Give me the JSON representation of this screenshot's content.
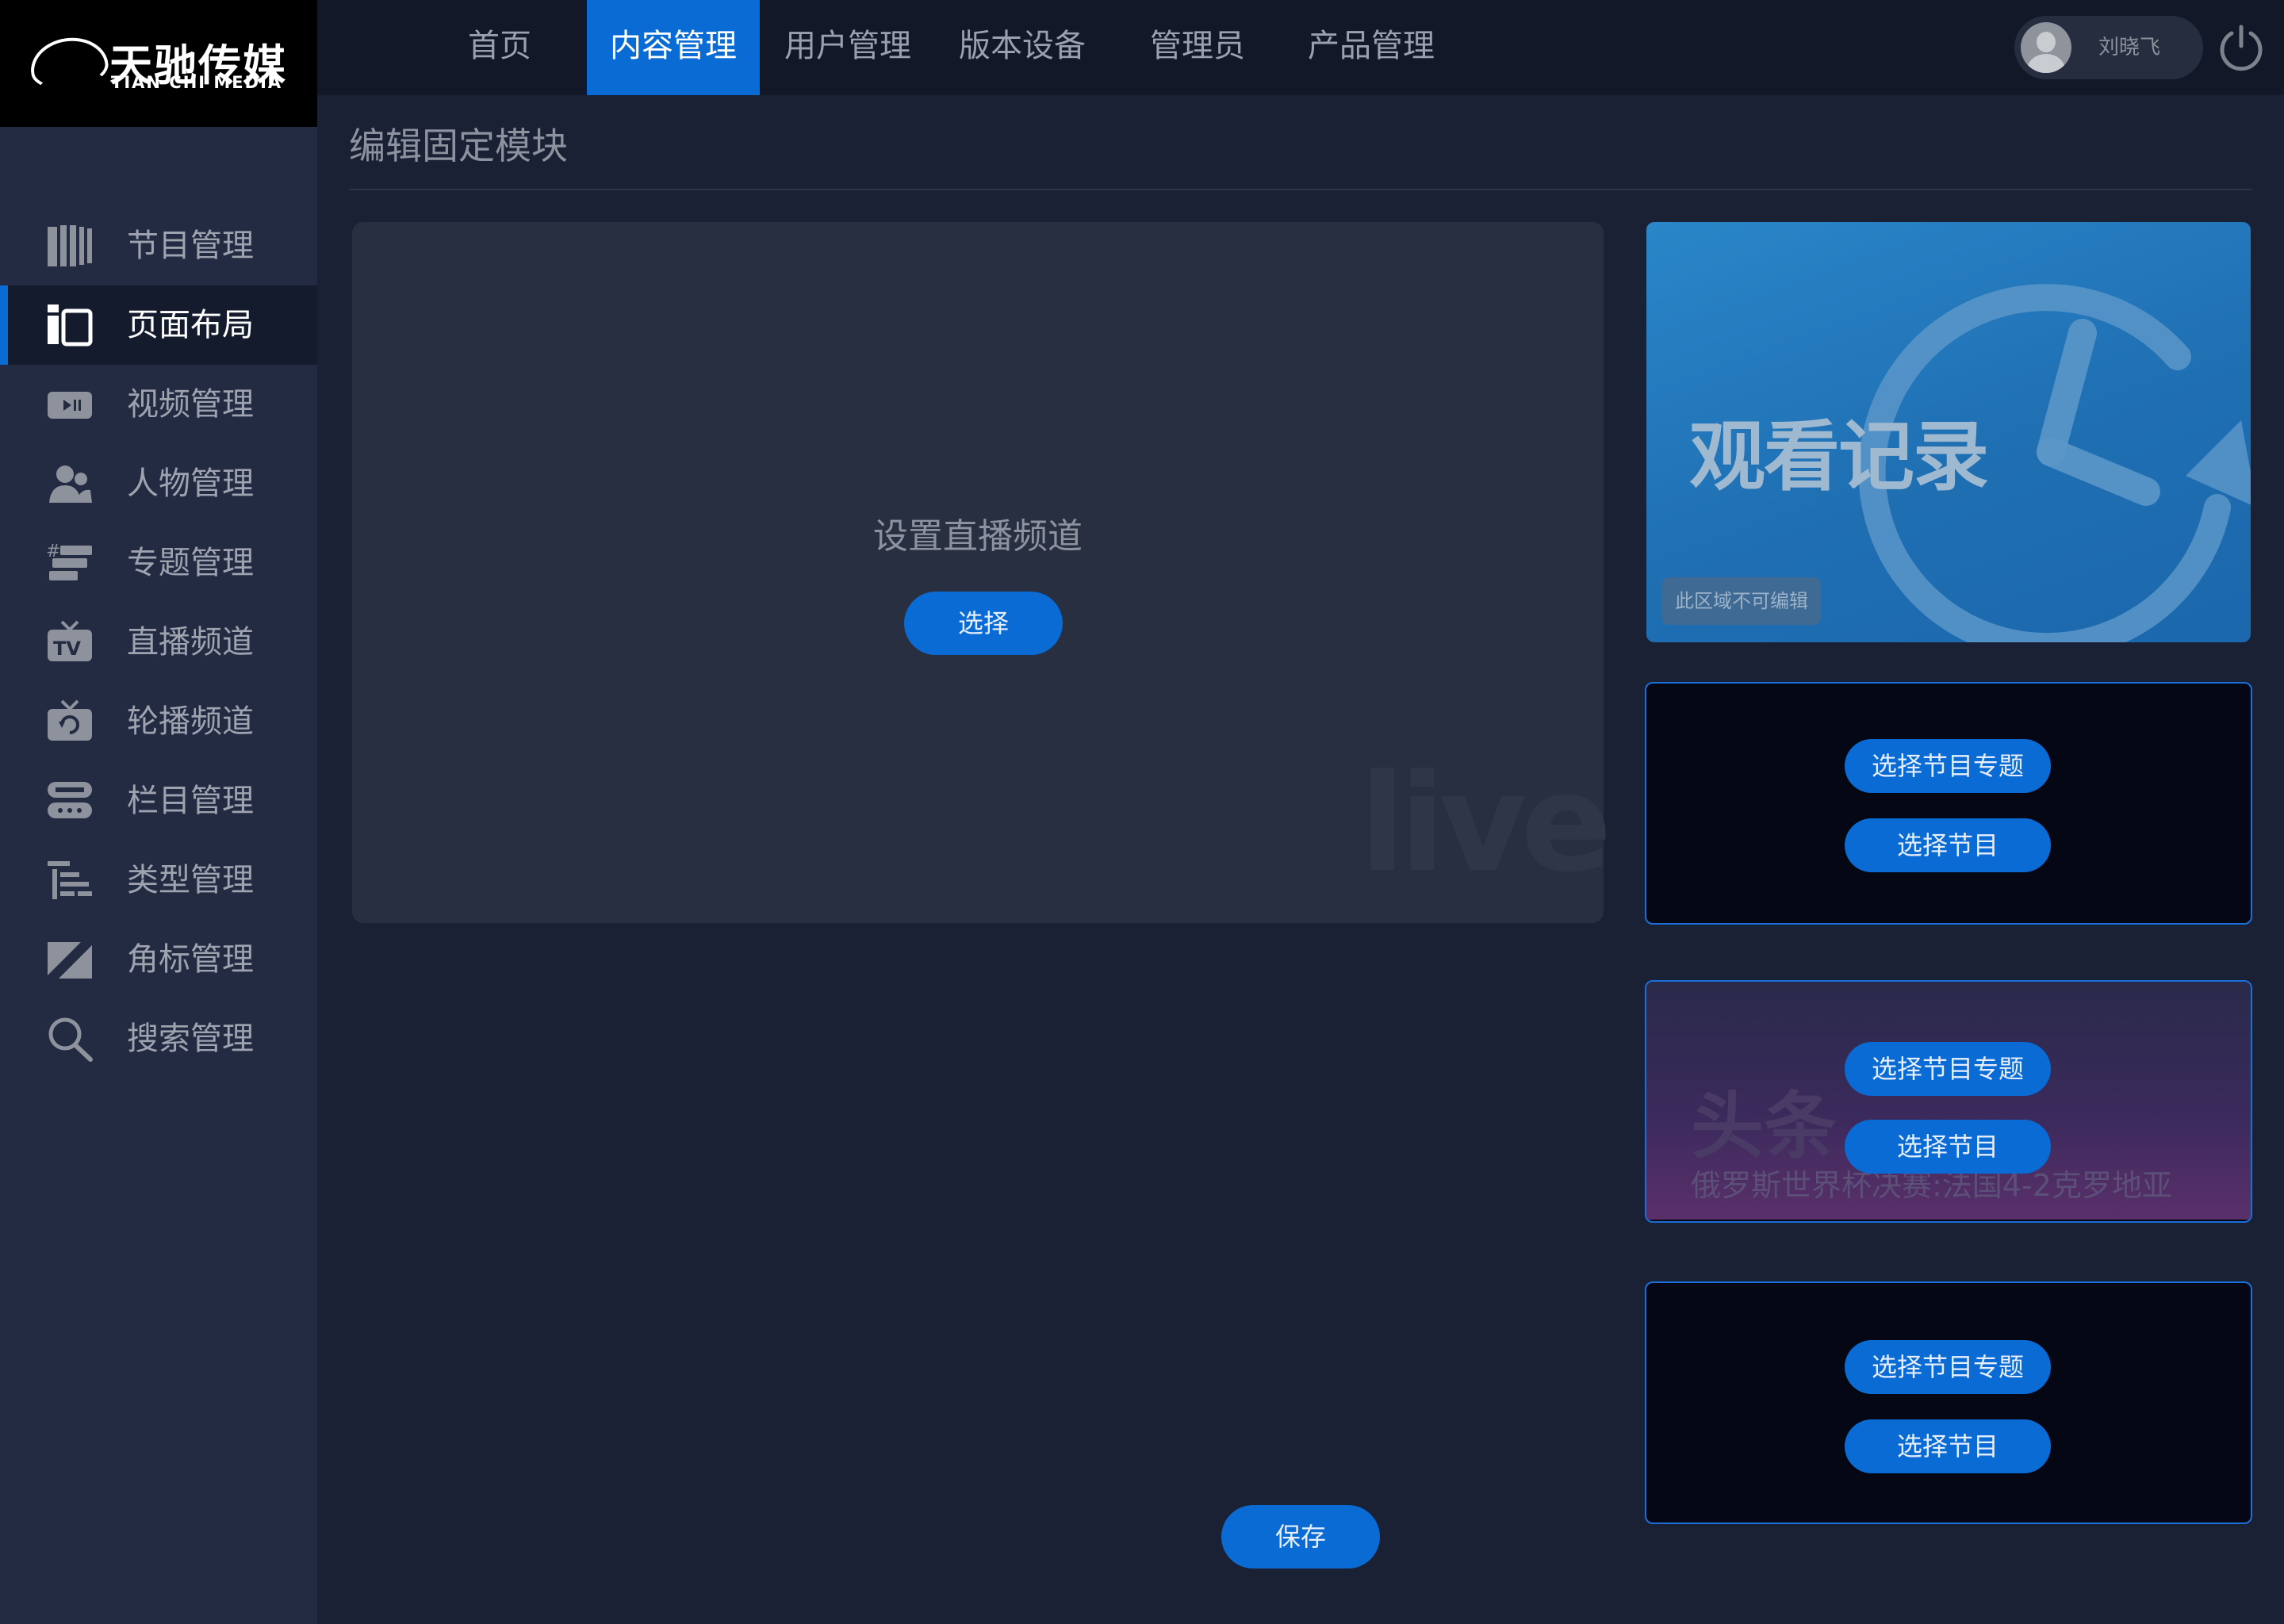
{
  "brand": {
    "cn": "天驰传媒",
    "en": "TIAN CHI MEDIA"
  },
  "nav": [
    {
      "label": "首页"
    },
    {
      "label": "内容管理",
      "active": true
    },
    {
      "label": "用户管理"
    },
    {
      "label": "版本设备"
    },
    {
      "label": "管理员"
    },
    {
      "label": "产品管理"
    }
  ],
  "user": {
    "name": "刘晓飞"
  },
  "sidebar": {
    "items": [
      {
        "label": "节目管理",
        "icon": "books-icon"
      },
      {
        "label": "页面布局",
        "icon": "layout-icon",
        "active": true
      },
      {
        "label": "视频管理",
        "icon": "video-icon"
      },
      {
        "label": "人物管理",
        "icon": "people-icon"
      },
      {
        "label": "专题管理",
        "icon": "topic-icon"
      },
      {
        "label": "直播频道",
        "icon": "tv-icon"
      },
      {
        "label": "轮播频道",
        "icon": "carousel-icon"
      },
      {
        "label": "栏目管理",
        "icon": "column-icon"
      },
      {
        "label": "类型管理",
        "icon": "type-list-icon"
      },
      {
        "label": "角标管理",
        "icon": "corner-badge-icon"
      },
      {
        "label": "搜索管理",
        "icon": "search-icon"
      }
    ]
  },
  "main": {
    "title": "编辑固定模块",
    "live": {
      "title": "设置直播频道",
      "button": "选择",
      "watermark": "live"
    },
    "history": {
      "title": "观看记录",
      "badge": "此区域不可编辑"
    },
    "slot1": {
      "topic_button": "选择节目专题",
      "program_button": "选择节目"
    },
    "slot2": {
      "topic_button": "选择节目专题",
      "program_button": "选择节目",
      "bg_title": "头条",
      "bg_subtitle": "俄罗斯世界杯决赛:法国4-2克罗地亚"
    },
    "slot3": {
      "topic_button": "选择节目专题",
      "program_button": "选择节目"
    },
    "save": "保存"
  },
  "colors": {
    "accent": "#0a6bd4",
    "topbar": "#121827",
    "sidebar": "#232b43",
    "background": "#1b2134"
  }
}
